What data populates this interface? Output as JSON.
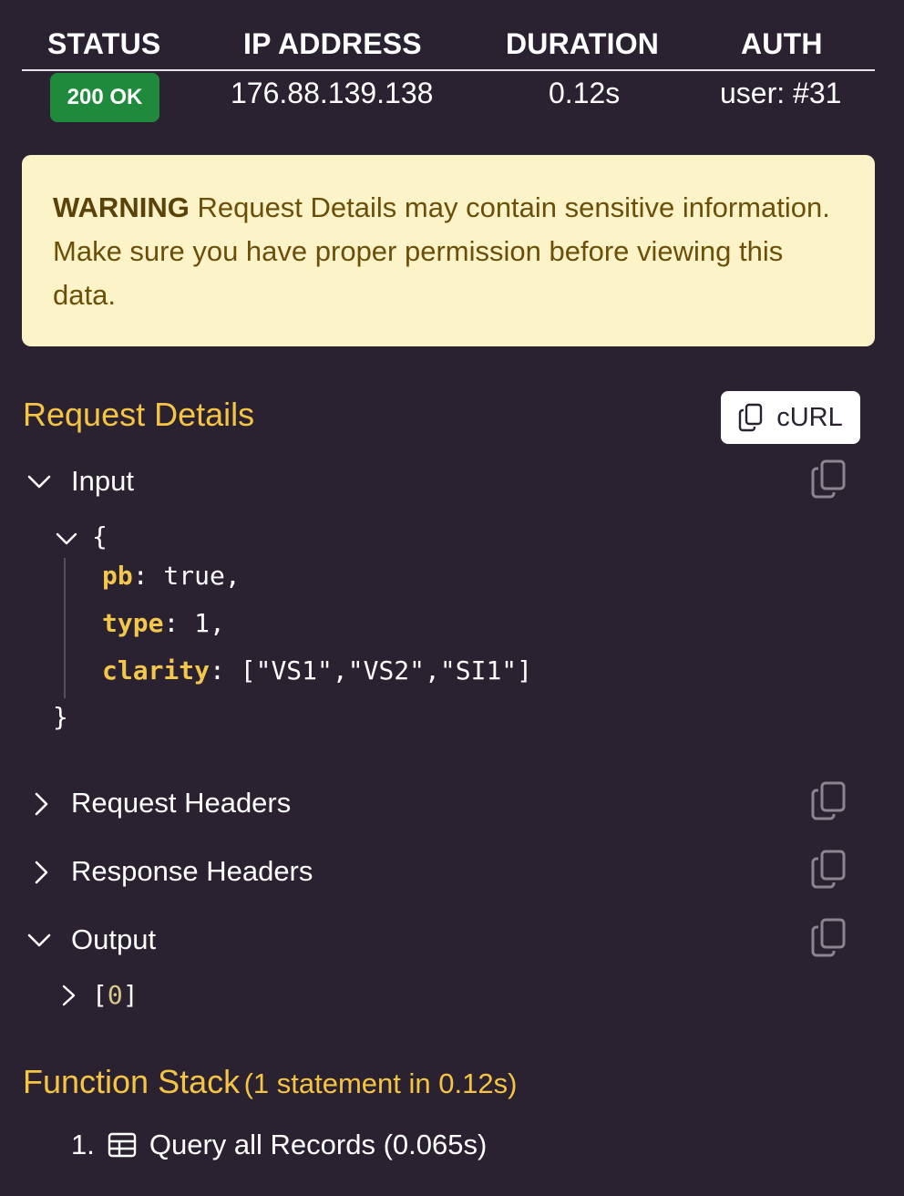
{
  "stats": {
    "headers": [
      "STATUS",
      "IP ADDRESS",
      "DURATION",
      "AUTH"
    ],
    "status_badge": "200 OK",
    "ip": "176.88.139.138",
    "duration": "0.12s",
    "auth": "user: #31"
  },
  "warning": {
    "label": "WARNING",
    "text": "Request Details may contain sensitive information. Make sure you have proper permission before viewing this data."
  },
  "request_details": {
    "title": "Request Details",
    "curl_label": "cURL",
    "input": {
      "label": "Input",
      "open_brace": "{",
      "close_brace": "}",
      "lines": [
        {
          "key": "pb",
          "value": ": true,"
        },
        {
          "key": "type",
          "value": ": 1,"
        },
        {
          "key": "clarity",
          "value": ": [\"VS1\",\"VS2\",\"SI1\"]"
        }
      ]
    },
    "request_headers_label": "Request Headers",
    "response_headers_label": "Response Headers",
    "output": {
      "label": "Output",
      "item_open": "[",
      "item_index": "0",
      "item_close": "]"
    }
  },
  "function_stack": {
    "title": "Function Stack",
    "summary": "(1 statement in 0.12s)",
    "items": [
      {
        "number": "1.",
        "label": "Query all Records (0.065s)",
        "icon": "table-icon"
      }
    ]
  },
  "colors": {
    "background": "#2a2230",
    "accent": "#f6c445",
    "success": "#1f8a3b",
    "warning_bg": "#fdf3c9"
  }
}
